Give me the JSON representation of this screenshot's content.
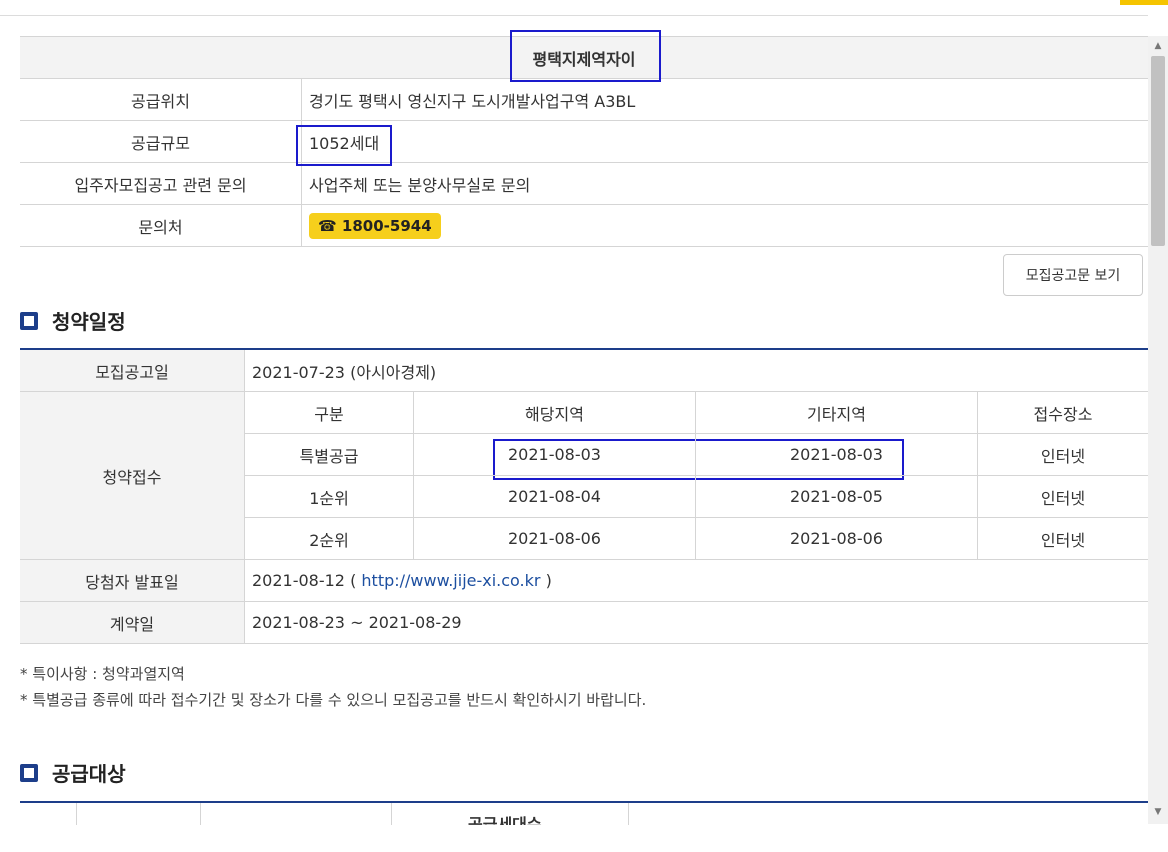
{
  "info_table": {
    "title": "평택지제역자이",
    "rows": [
      {
        "label": "공급위치",
        "value": "경기도 평택시 영신지구 도시개발사업구역 A3BL"
      },
      {
        "label": "공급규모",
        "value": "1052세대"
      },
      {
        "label": "입주자모집공고 관련 문의",
        "value": "사업주체 또는 분양사무실로 문의"
      },
      {
        "label": "문의처",
        "value": "☎ 1800-5944"
      }
    ]
  },
  "notice_button": "모집공고문 보기",
  "schedule": {
    "title": "청약일정",
    "announce_label": "모집공고일",
    "announce_value": "2021-07-23 (아시아경제)",
    "receipt_label": "청약접수",
    "headers": [
      "구분",
      "해당지역",
      "기타지역",
      "접수장소"
    ],
    "rows": [
      [
        "특별공급",
        "2021-08-03",
        "2021-08-03",
        "인터넷"
      ],
      [
        "1순위",
        "2021-08-04",
        "2021-08-05",
        "인터넷"
      ],
      [
        "2순위",
        "2021-08-06",
        "2021-08-06",
        "인터넷"
      ]
    ],
    "winner_label": "당첨자 발표일",
    "winner_date": "2021-08-12 (",
    "winner_url": "http://www.jije-xi.co.kr",
    "winner_close": ")",
    "contract_label": "계약일",
    "contract_value": "2021-08-23 ~ 2021-08-29"
  },
  "notes": [
    "* 특이사항 : 청약과열지역",
    "* 특별공급 종류에 따라 접수기간 및 장소가 다를 수 있으니 모집공고를 반드시 확인하시기 바랍니다."
  ],
  "supply": {
    "title": "공급대상",
    "partial_header": "공급세대수"
  },
  "colors": {
    "accent_navy": "#1d3e8a",
    "phone_badge": "#f6cf1c",
    "highlight_box": "#1a1acc",
    "link": "#1d4fa0"
  }
}
